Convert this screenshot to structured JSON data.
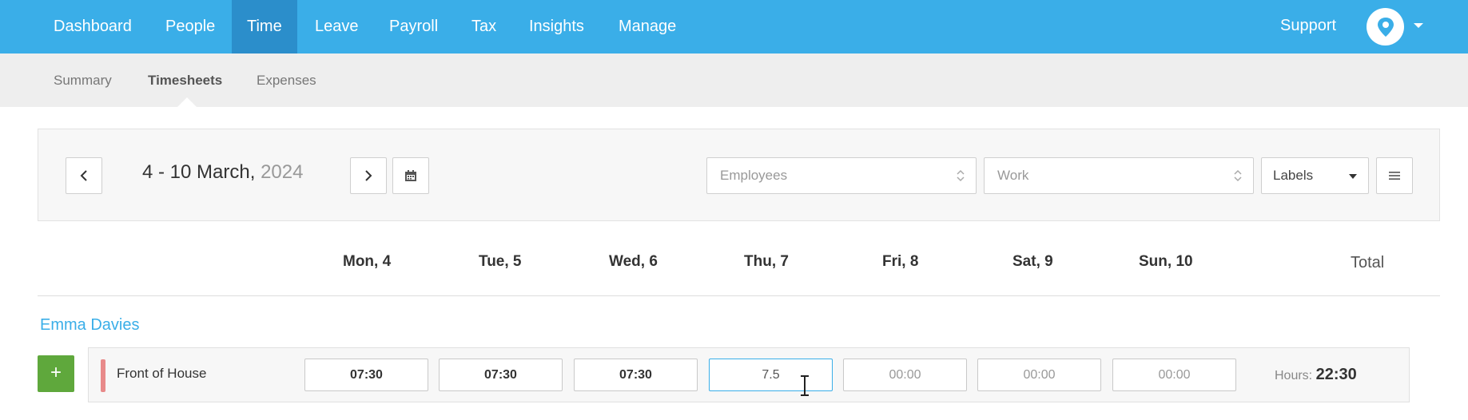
{
  "nav": {
    "items": [
      {
        "label": "Dashboard"
      },
      {
        "label": "People"
      },
      {
        "label": "Time"
      },
      {
        "label": "Leave"
      },
      {
        "label": "Payroll"
      },
      {
        "label": "Tax"
      },
      {
        "label": "Insights"
      },
      {
        "label": "Manage"
      }
    ],
    "active": "Time",
    "support": "Support"
  },
  "subnav": {
    "items": [
      {
        "label": "Summary"
      },
      {
        "label": "Timesheets"
      },
      {
        "label": "Expenses"
      }
    ],
    "active": "Timesheets"
  },
  "toolbar": {
    "range": "4 - 10 March,",
    "year": "2024",
    "employees_placeholder": "Employees",
    "work_placeholder": "Work",
    "labels": "Labels"
  },
  "days": [
    "Mon, 4",
    "Tue, 5",
    "Wed, 6",
    "Thu, 7",
    "Fri, 8",
    "Sat, 9",
    "Sun, 10"
  ],
  "total_label": "Total",
  "employee": {
    "name": "Emma Davies",
    "add_label": "+",
    "row": {
      "label": "Front of House",
      "color": "#e88a8a",
      "cells": [
        "07:30",
        "07:30",
        "07:30",
        "7.5",
        "00:00",
        "00:00",
        "00:00"
      ],
      "hours_label": "Hours:",
      "hours_value": "22:30"
    }
  },
  "colors": {
    "brand": "#3aaee8",
    "active_tab": "#2b8ecb",
    "add": "#5fa83c"
  },
  "icons": [
    "chevron-left-icon",
    "chevron-right-icon",
    "calendar-icon",
    "menu-icon",
    "avatar-icon",
    "caret-down-icon"
  ]
}
